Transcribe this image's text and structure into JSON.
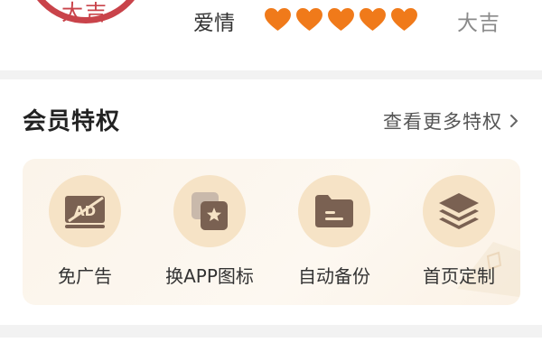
{
  "fortune": {
    "seal_text": "大吉",
    "love_label": "爱情",
    "hearts_total": 5,
    "hearts_filled": 5,
    "love_result": "大吉"
  },
  "member": {
    "title": "会员特权",
    "more_label": "查看更多特权",
    "benefits": [
      {
        "label": "免广告",
        "icon": "no-ads-icon"
      },
      {
        "label": "换APP图标",
        "icon": "app-icon-swap-icon"
      },
      {
        "label": "自动备份",
        "icon": "folder-backup-icon"
      },
      {
        "label": "首页定制",
        "icon": "layers-icon"
      }
    ]
  },
  "colors": {
    "seal_red": "#c9434a",
    "heart_orange": "#f07a1a",
    "icon_brown": "#7a6152",
    "icon_bg": "#f6e3c6"
  }
}
